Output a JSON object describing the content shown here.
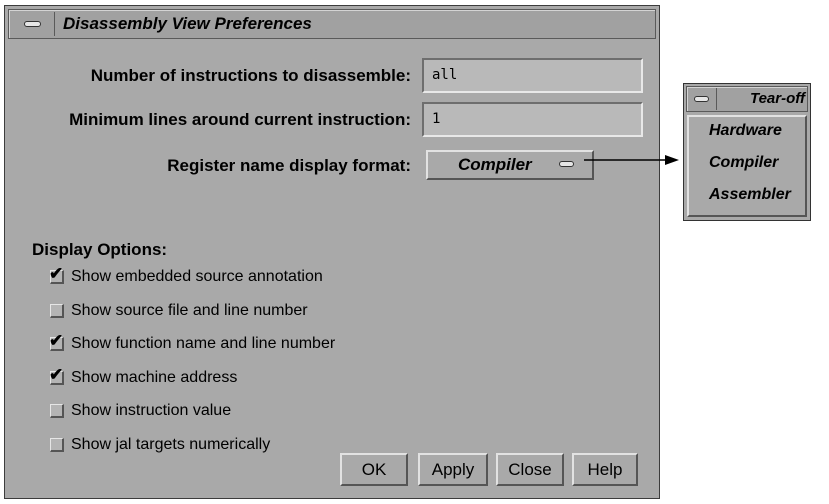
{
  "window": {
    "title": "Disassembly View Preferences"
  },
  "form": {
    "instructions_label": "Number of instructions to disassemble:",
    "instructions_value": "all",
    "min_lines_label": "Minimum lines around current instruction:",
    "min_lines_value": "1",
    "register_label": "Register name display format:",
    "register_value": "Compiler"
  },
  "display_options": {
    "heading": "Display Options:",
    "items": [
      {
        "label": "Show embedded source annotation",
        "checked": true
      },
      {
        "label": "Show source file and line number",
        "checked": false
      },
      {
        "label": "Show function name and line number",
        "checked": true
      },
      {
        "label": "Show machine address",
        "checked": true
      },
      {
        "label": "Show instruction value",
        "checked": false
      },
      {
        "label": "Show jal targets numerically",
        "checked": false
      }
    ]
  },
  "buttons": {
    "ok": "OK",
    "apply": "Apply",
    "close": "Close",
    "help": "Help"
  },
  "tearoff": {
    "title": "Tear-off",
    "items": [
      "Hardware",
      "Compiler",
      "Assembler"
    ]
  },
  "icons": {
    "window_menu": "window-menu-icon",
    "option_indicator": "option-menu-indicator-icon",
    "checkmark": "checkmark-icon",
    "arrow": "arrow-right-icon"
  },
  "colors": {
    "window_bg": "#a9a9a9",
    "field_bg": "#b9b9b9",
    "text": "#000000"
  }
}
